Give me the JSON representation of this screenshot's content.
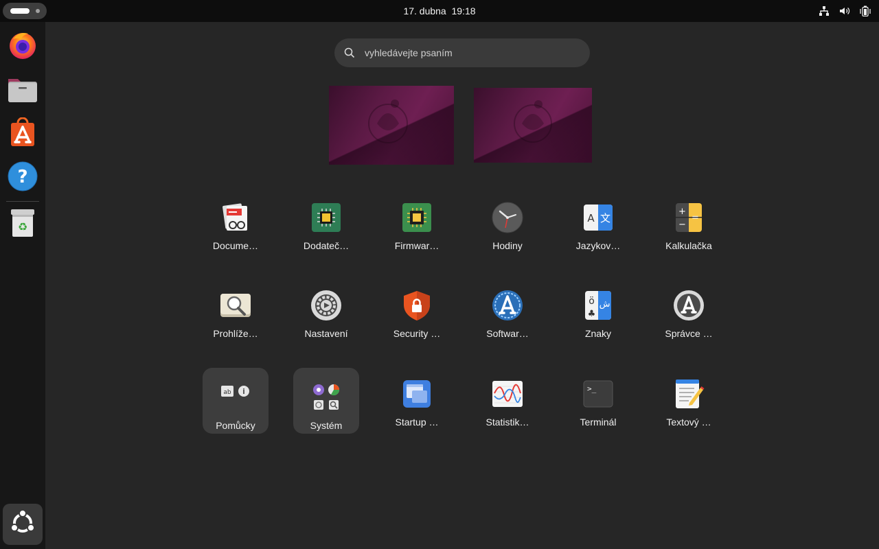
{
  "topbar": {
    "date": "17. dubna",
    "time": "19:18",
    "tray_icons": [
      "network-icon",
      "volume-icon",
      "battery-icon"
    ]
  },
  "dock": {
    "items": [
      "firefox-icon",
      "files-icon",
      "app-center-icon",
      "help-icon",
      "trash-icon"
    ],
    "show_apps_icon": "ubuntu-logo-icon"
  },
  "search": {
    "placeholder": "vyhledávejte psaním",
    "value": ""
  },
  "workspaces": {
    "count": 2,
    "wallpaper_colors": [
      "#5c1a45",
      "#3a0f2c"
    ]
  },
  "apps": {
    "row1": [
      {
        "label": "Docume…",
        "icon": "document-viewer-icon"
      },
      {
        "label": "Dodateč…",
        "icon": "chip-icon"
      },
      {
        "label": "Firmwar…",
        "icon": "firmware-icon"
      },
      {
        "label": "Hodiny",
        "icon": "clock-icon"
      },
      {
        "label": "Jazykov…",
        "icon": "language-icon"
      },
      {
        "label": "Kalkulačka",
        "icon": "calculator-icon"
      }
    ],
    "row2": [
      {
        "label": "Prohlíže…",
        "icon": "image-viewer-icon"
      },
      {
        "label": "Nastavení",
        "icon": "settings-icon"
      },
      {
        "label": "Security …",
        "icon": "security-icon"
      },
      {
        "label": "Softwar…",
        "icon": "software-updater-icon"
      },
      {
        "label": "Znaky",
        "icon": "characters-icon"
      },
      {
        "label": "Správce …",
        "icon": "software-manager-icon"
      }
    ],
    "row3": [
      {
        "label": "Pomůcky",
        "icon": "folder-utilities-icon"
      },
      {
        "label": "Systém",
        "icon": "folder-system-icon"
      },
      {
        "label": "Startup …",
        "icon": "startup-disk-icon"
      },
      {
        "label": "Statistik…",
        "icon": "statistics-icon"
      },
      {
        "label": "Terminál",
        "icon": "terminal-icon"
      },
      {
        "label": "Textový …",
        "icon": "text-editor-icon"
      }
    ]
  },
  "colors": {
    "background": "#262626",
    "topbar": "#0d0d0d",
    "dock": "#171717",
    "accent_orange": "#e95420"
  }
}
